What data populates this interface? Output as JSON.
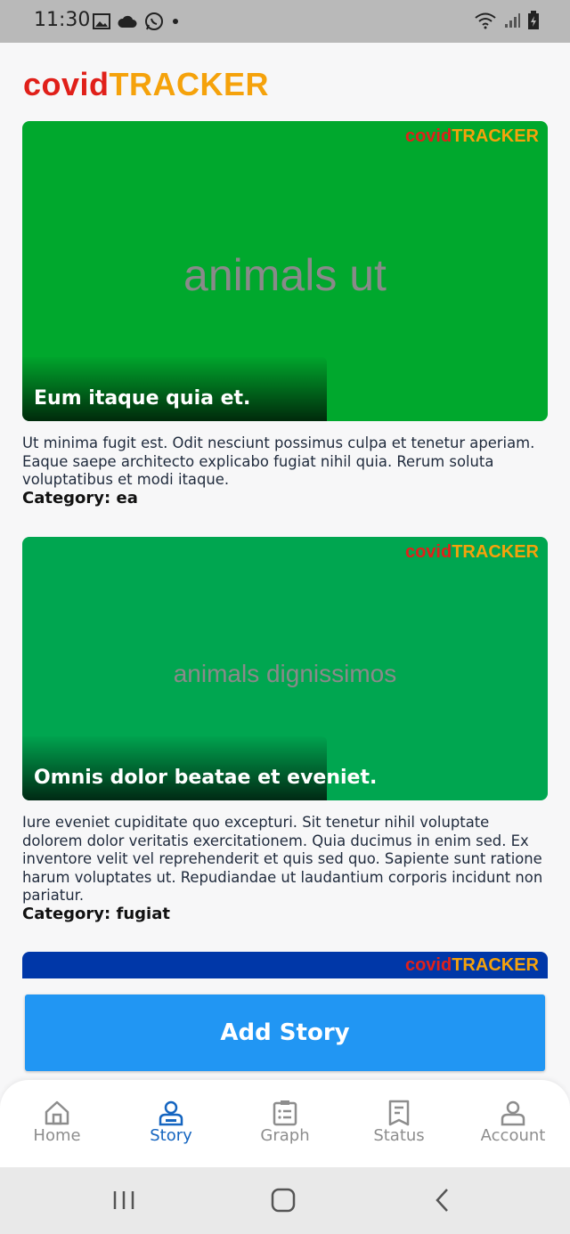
{
  "status_bar": {
    "time": "11:30"
  },
  "app": {
    "logo_part1": "covid",
    "logo_part2": "TRACKER"
  },
  "stories": [
    {
      "image_text": "animals ut",
      "title": "Eum itaque quia et.",
      "description": "Ut minima fugit est. Odit nesciunt possimus culpa et tenetur aperiam. Eaque saepe architecto explicabo fugiat nihil quia. Rerum soluta voluptatibus et modi itaque.",
      "category": "Category: ea",
      "bg_color": "#00a82d"
    },
    {
      "image_text": "animals dignissimos",
      "title": "Omnis dolor beatae et eveniet.",
      "description": "Iure eveniet cupiditate quo excepturi. Sit tenetur nihil voluptate dolorem dolor veritatis exercitationem. Quia ducimus in enim sed. Ex inventore velit vel reprehenderit et quis sed quo. Sapiente sunt ratione harum voluptates ut. Repudiandae ut laudantium corporis incidunt non pariatur.",
      "category": "Category: fugiat",
      "bg_color": "#00a650"
    },
    {
      "bg_color": "#0037a8"
    }
  ],
  "add_story": {
    "label": "Add Story",
    "color": "#2196f3"
  },
  "bottom_nav": [
    {
      "label": "Home",
      "icon": "home-icon",
      "active": false
    },
    {
      "label": "Story",
      "icon": "person-icon",
      "active": true
    },
    {
      "label": "Graph",
      "icon": "clipboard-list-icon",
      "active": false
    },
    {
      "label": "Status",
      "icon": "receipt-icon",
      "active": false
    },
    {
      "label": "Account",
      "icon": "account-icon",
      "active": false
    }
  ],
  "colors": {
    "active_nav": "#1565c0",
    "inactive_nav": "#8d8d8d",
    "logo_red": "#e0201a",
    "logo_orange": "#f5a20b"
  }
}
